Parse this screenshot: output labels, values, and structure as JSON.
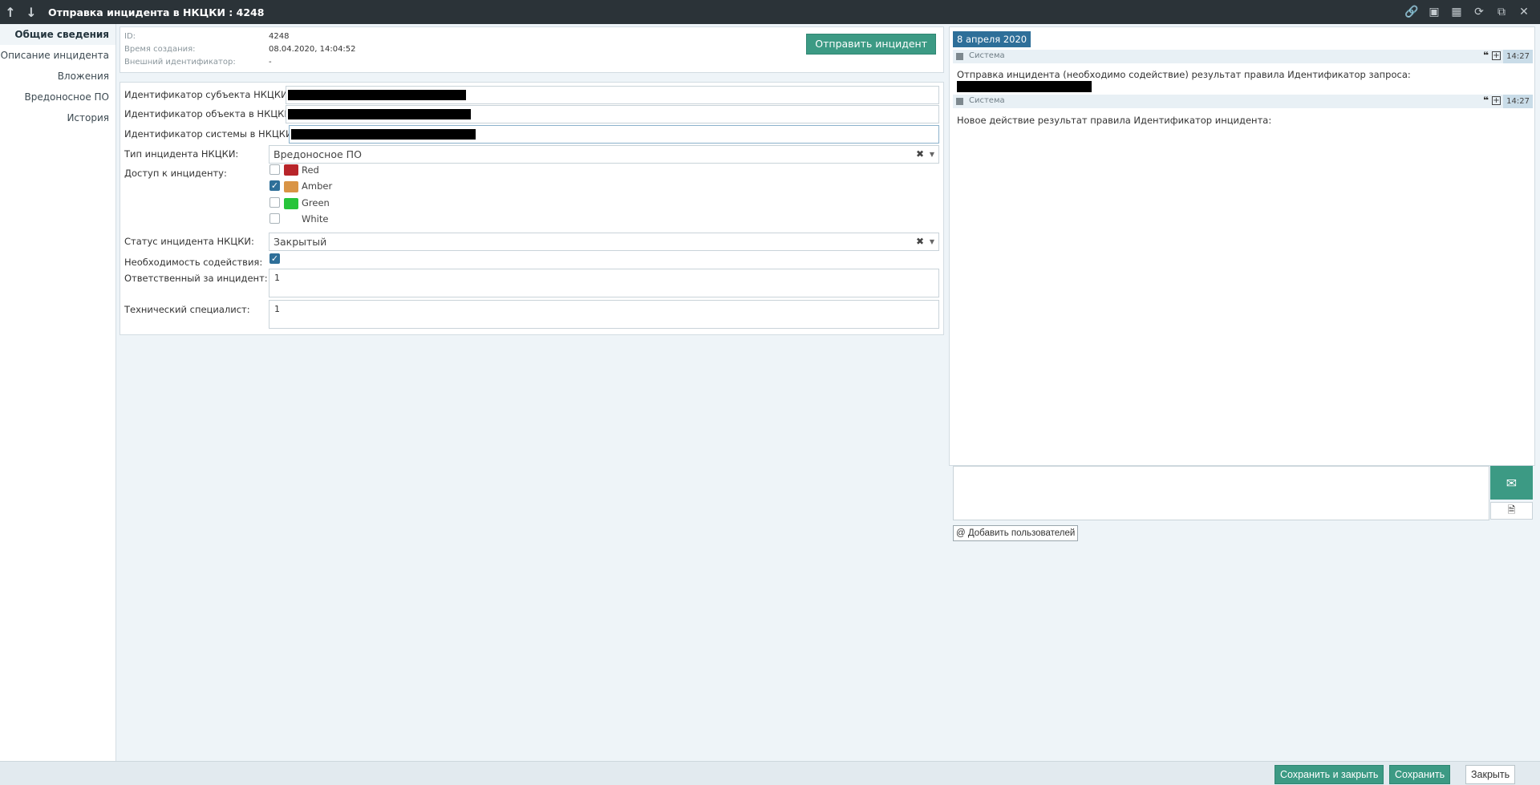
{
  "window": {
    "title": "Отправка инцидента в НКЦКИ : 4248",
    "nav_up_icon": "arrow-up-icon",
    "nav_down_icon": "arrow-down-icon",
    "toolbar_icons": [
      "link-icon",
      "screenshot-icon",
      "camera-icon",
      "refresh-icon",
      "restore-window-icon",
      "close-icon"
    ]
  },
  "sidebar": {
    "items": [
      {
        "label": "Общие сведения",
        "active": true
      },
      {
        "label": "Описание инцидента",
        "active": false
      },
      {
        "label": "Вложения",
        "active": false
      },
      {
        "label": "Вредоносное ПО",
        "active": false
      },
      {
        "label": "История",
        "active": false
      }
    ]
  },
  "info": {
    "id_label": "ID:",
    "id_value": "4248",
    "created_label": "Время создания:",
    "created_value": "08.04.2020, 14:04:52",
    "external_label": "Внешний идентификатор:",
    "external_value": "-",
    "send_button": "Отправить инцидент"
  },
  "form": {
    "subject_label": "Идентификатор субъекта НКЦКИ:",
    "object_label": "Идентификатор объекта в НКЦКИ:",
    "system_label": "Идентификатор системы в НКЦКИ:",
    "incident_type_label": "Тип инцидента НКЦКИ:",
    "incident_type_value": "Вредоносное ПО",
    "access_label": "Доступ к инциденту:",
    "tlp": [
      {
        "label": "Red",
        "checked": false,
        "color": "#b8252a"
      },
      {
        "label": "Amber",
        "checked": true,
        "color": "#d99445"
      },
      {
        "label": "Green",
        "checked": false,
        "color": "#27c43a"
      },
      {
        "label": "White",
        "checked": false,
        "color": ""
      }
    ],
    "status_label": "Статус инцидента НКЦКИ:",
    "status_value": "Закрытый",
    "assistance_label": "Необходимость содействия:",
    "assistance_checked": true,
    "responsible_label": "Ответственный за инцидент:",
    "responsible_value": "1",
    "tech_label": "Технический специалист:",
    "tech_value": "1",
    "clear_icon": "clear-x-icon",
    "caret_icon": "caret-down-icon"
  },
  "feed": {
    "date": "8 апреля 2020",
    "messages": [
      {
        "author": "Система",
        "time": "14:27",
        "text": "Отправка инцидента (необходимо содействие) результат правила Идентификатор запроса:"
      },
      {
        "author": "Система",
        "time": "14:27",
        "text": "Новое действие результат правила Идентификатор инцидента:"
      }
    ],
    "add_users": "@ Добавить пользователей"
  },
  "footer": {
    "save_close": "Сохранить и закрыть",
    "save": "Сохранить",
    "close": "Закрыть"
  },
  "colors": {
    "accent_green": "#3c9a84",
    "accent_blue": "#2e6f99",
    "titlebar": "#2b3338"
  }
}
